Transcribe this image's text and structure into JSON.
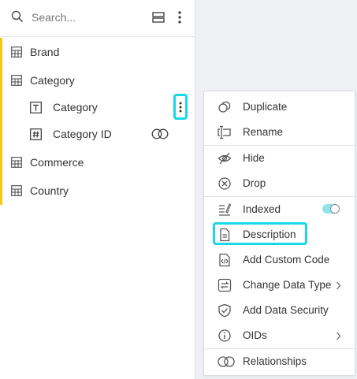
{
  "search": {
    "placeholder": "Search..."
  },
  "tree": {
    "items": [
      {
        "label": "Brand"
      },
      {
        "label": "Category"
      },
      {
        "label": "Category"
      },
      {
        "label": "Category ID"
      },
      {
        "label": "Commerce"
      },
      {
        "label": "Country"
      }
    ]
  },
  "context_menu": {
    "items": [
      {
        "label": "Duplicate"
      },
      {
        "label": "Rename"
      },
      {
        "label": "Hide"
      },
      {
        "label": "Drop"
      },
      {
        "label": "Indexed"
      },
      {
        "label": "Description"
      },
      {
        "label": "Add Custom Code"
      },
      {
        "label": "Change Data Type"
      },
      {
        "label": "Add Data Security"
      },
      {
        "label": "OIDs"
      },
      {
        "label": "Relationships"
      }
    ],
    "indexed_toggle_on": true
  },
  "colors": {
    "highlight": "#19d6e8",
    "tree_accent": "#f5c518",
    "toggle_track": "#8fe3ea"
  }
}
